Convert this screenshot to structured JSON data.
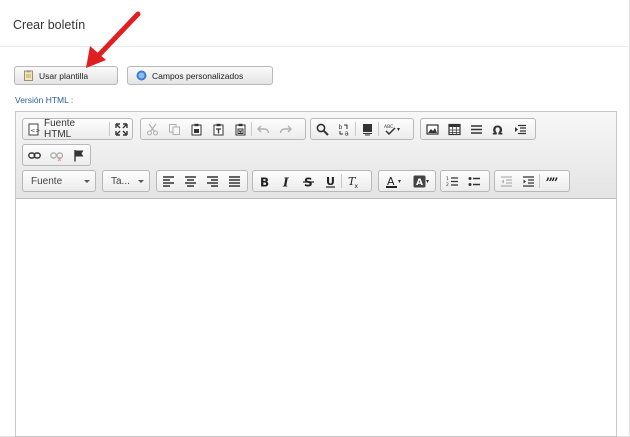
{
  "panel": {
    "title": "Crear boletín"
  },
  "actions": {
    "use_template": "Usar plantilla",
    "custom_fields": "Campos personalizados"
  },
  "editor": {
    "label": "Versión HTML :",
    "source_button": "Fuente HTML",
    "font_combo": "Fuente",
    "size_combo": "Ta...",
    "toolbar_icons": [
      "source-icon",
      "maximize-icon",
      "cut-icon",
      "copy-icon",
      "paste-icon",
      "paste-text-icon",
      "paste-word-icon",
      "undo-icon",
      "redo-icon",
      "find-icon",
      "replace-icon",
      "select-all-icon",
      "spellcheck-icon",
      "image-icon",
      "table-icon",
      "horizontal-rule-icon",
      "special-char-icon",
      "page-break-icon",
      "link-icon",
      "unlink-icon",
      "anchor-icon",
      "align-left-icon",
      "align-center-icon",
      "align-right-icon",
      "justify-icon",
      "bold-icon",
      "italic-icon",
      "strike-icon",
      "underline-icon",
      "remove-format-icon",
      "text-color-icon",
      "bg-color-icon",
      "numbered-list-icon",
      "bulleted-list-icon",
      "outdent-icon",
      "indent-icon",
      "blockquote-icon"
    ]
  },
  "colors": {
    "arrow": "#e02020",
    "label": "#2b5f9a"
  }
}
